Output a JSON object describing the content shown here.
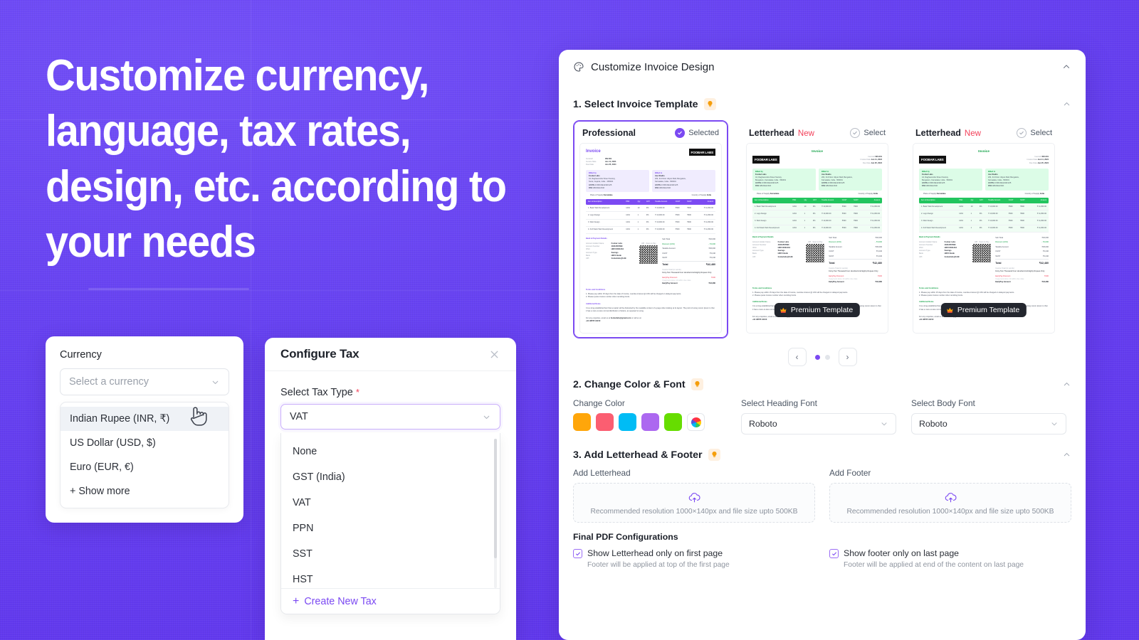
{
  "background": {
    "color": "#6B45F5"
  },
  "headline": "Customize currency, language, tax rates, design, etc. according to your needs",
  "currency_card": {
    "label": "Currency",
    "select_placeholder": "Select a currency",
    "options": [
      "Indian Rupee (INR, ₹)",
      "US Dollar (USD, $)",
      "Euro (EUR, €)",
      "+ Show more"
    ],
    "hovered_option_index": 0
  },
  "tax_modal": {
    "title": "Configure Tax",
    "close_label": "×",
    "field_label": "Select Tax Type",
    "required_mark": "*",
    "selected_value": "VAT",
    "options": [
      "None",
      "GST (India)",
      "VAT",
      "PPN",
      "SST",
      "HST"
    ],
    "create_new_label": "Create New Tax",
    "create_new_plus": "+"
  },
  "design_panel": {
    "header_title": "Customize Invoice Design",
    "header_icon": "palette-icon",
    "collapse_icon": "chevron-up-icon",
    "sections": [
      {
        "title": "1. Select Invoice Template",
        "badge_icon": "lightbulb-icon"
      },
      {
        "title": "2. Change Color & Font",
        "badge_icon": "lightbulb-icon"
      },
      {
        "title": "3. Add Letterhead & Footer",
        "badge_icon": "lightbulb-icon"
      }
    ],
    "templates": [
      {
        "name": "Professional",
        "new_tag": "",
        "action_label": "Selected",
        "selected": true,
        "premium": false,
        "accent": "#7B49F2"
      },
      {
        "name": "Letterhead",
        "new_tag": "New",
        "action_label": "Select",
        "selected": false,
        "premium": true,
        "accent": "#22C55E"
      },
      {
        "name": "Letterhead",
        "new_tag": "New",
        "action_label": "Select",
        "selected": false,
        "premium": true,
        "accent": "#22C55E"
      }
    ],
    "premium_badge_label": "Premium Template",
    "carousel": {
      "prev": "‹",
      "next": "›",
      "dots": 2,
      "active_dot": 0
    },
    "color_font": {
      "change_color_label": "Change Color",
      "swatches": [
        "#FFA60A",
        "#FB5E71",
        "#00BCF5",
        "#AC68F0",
        "#66DD00"
      ],
      "custom_picker_icon": "color-wheel-icon",
      "heading_font_label": "Select Heading Font",
      "heading_font_value": "Roboto",
      "body_font_label": "Select Body Font",
      "body_font_value": "Roboto"
    },
    "letterhead": {
      "add_letterhead_label": "Add Letterhead",
      "add_footer_label": "Add Footer",
      "upload_hint": "Recommended resolution 1000×140px and file size upto 500KB",
      "upload_icon": "cloud-upload-icon",
      "final_pdf_label": "Final PDF Configurations",
      "checkboxes": [
        {
          "label": "Show Letterhead only on first page",
          "sub": "Footer will be applied at top of the first page",
          "checked": true
        },
        {
          "label": "Show footer only on last page",
          "sub": "Footer will be applied at end of the content on last page",
          "checked": true
        }
      ]
    },
    "invoice_preview": {
      "title": "Invoice",
      "company": "FOOBAR LABS",
      "meta": [
        {
          "k": "Invoice#",
          "v": "INV-001"
        },
        {
          "k": "Invoice Date",
          "v": "Jun 11, 2024"
        },
        {
          "k": "Due Date",
          "v": "Jun 25, 2024"
        }
      ],
      "billed_by_label": "Billed by",
      "billed_to_label": "Billed to",
      "billed_by": [
        "Foobar Labs",
        "44, Raghavendra Street Society,",
        "Surat, Gujarat, India - 395004",
        "GSTIN  27ABCDE1234F1Z5",
        "PAN  ABCDE1234F"
      ],
      "billed_to": [
        "Ace Studio",
        "204, 3rd Floor Udyan Mall, Bengaluru,",
        "Karnataka, India - 560001",
        "GSTIN  27ABCDE1234F1Z5",
        "PAN  ABCDE1234F"
      ],
      "place_of_supply_label": "Place of Supply",
      "place_of_supply": "Karnataka",
      "country_of_supply_label": "Country of Supply",
      "country_of_supply": "India",
      "columns": [
        "Item & Description",
        "HSN",
        "Qty",
        "GST",
        "Taxable Amount",
        "CGST",
        "SGST",
        "Amount"
      ],
      "rows": [
        [
          "1. Basic Web Development",
          "1234",
          "10",
          "9%",
          "₹ 10,000.00",
          "₹900",
          "₹900",
          "₹ 11,800.00"
        ],
        [
          "2. Logo Design",
          "1234",
          "1",
          "9%",
          "₹ 10,000.00",
          "₹900",
          "₹900",
          "₹ 11,800.00"
        ],
        [
          "3. Web Design",
          "1234",
          "1",
          "9%",
          "₹ 10,000.00",
          "₹900",
          "₹900",
          "₹ 11,800.00"
        ],
        [
          "4. Full Stack Web Development",
          "1234",
          "1",
          "9%",
          "₹ 10,000.00",
          "₹900",
          "₹900",
          "₹ 11,800.00"
        ]
      ],
      "bank_label": "Bank & Payment Details",
      "bank_rows": [
        [
          "Account Holder Name",
          "Foobar Labs"
        ],
        [
          "Account Number",
          "40234567890"
        ],
        [
          "IFSC",
          "HDFC0001234"
        ],
        [
          "Account Type",
          "Savings"
        ],
        [
          "Bank",
          "HDFC Bank"
        ],
        [
          "UPI",
          "foobarlabs@hdfc"
        ]
      ],
      "qr_label": "UPI - Scan to Pay",
      "totals": [
        [
          "Sub Total",
          "₹40,000"
        ],
        [
          "Discount (10%)",
          "- ₹4,000"
        ],
        [
          "Taxable Amount",
          "₹36,000"
        ],
        [
          "CGST",
          "₹3,240"
        ],
        [
          "SGST",
          "₹3,240"
        ]
      ],
      "total_label": "Total",
      "total_value": "₹42,480",
      "in_words_label": "Invoice Total (in words)",
      "in_words": "Forty-Two Thousand Four Hundred And Eighty Rupees Only",
      "early_discount_label": "EarlyPay Discount",
      "early_discount_value": "₹200",
      "early_discount_sub": "if payment done 10 within due date",
      "early_amount_label": "EarlyPay Amount",
      "early_amount_value": "₹42,280",
      "terms_label": "Terms and Conditions",
      "terms": [
        "1. Please pay within 15 days from the date of invoice, overdue interest @ 14% will be charged on delayed payments.",
        "2. Please quote invoice number when remitting funds."
      ],
      "notes_label": "Additional Notes",
      "notes": "It is a long established fact that a reader will be distracted by the readable content of a page when looking at its layout. The point of using Lorem Ipsum is that it has a more-or-less normal distribution of letters, as opposed to using.",
      "footer": "For any enquiries, email us at foobarlabs@gmail.com or call us on +91 98765 43210"
    }
  }
}
